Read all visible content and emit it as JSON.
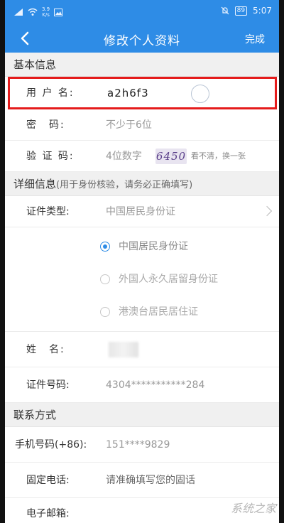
{
  "status": {
    "speed_value": "3.9",
    "speed_unit": "K/s",
    "battery": "89",
    "time": "5:07"
  },
  "nav": {
    "title": "修改个人资料",
    "done_label": "完成"
  },
  "basic": {
    "header": "基本信息",
    "username_label": "用 户 名:",
    "username_value": "a2h6f3",
    "password_label": "密　码:",
    "password_placeholder": "不少于6位",
    "captcha_label": "验 证 码:",
    "captcha_placeholder": "4位数字",
    "captcha_image_text": "6450",
    "captcha_refresh": "看不清，换一张"
  },
  "detail": {
    "header": "详细信息",
    "header_note": "(用于身份核验，请务必正确填写)",
    "id_type_label": "证件类型:",
    "id_type_value": "中国居民身份证",
    "id_type_options": [
      {
        "label": "中国居民身份证",
        "checked": true
      },
      {
        "label": "外国人永久居留身份证",
        "checked": false
      },
      {
        "label": "港澳台居民居住证",
        "checked": false
      }
    ],
    "name_label": "姓　名:",
    "id_number_label": "证件号码:",
    "id_number_value": "4304***********284"
  },
  "contact": {
    "header": "联系方式",
    "mobile_label": "手机号码(+86):",
    "mobile_value": "151****9829",
    "landline_label": "固定电话:",
    "landline_placeholder": "请准确填写您的固话",
    "email_label": "电子邮箱:"
  },
  "watermark": {
    "text": "系统之家"
  },
  "colors": {
    "accent": "#2e8ce6",
    "highlight_border": "#e51c1c"
  }
}
